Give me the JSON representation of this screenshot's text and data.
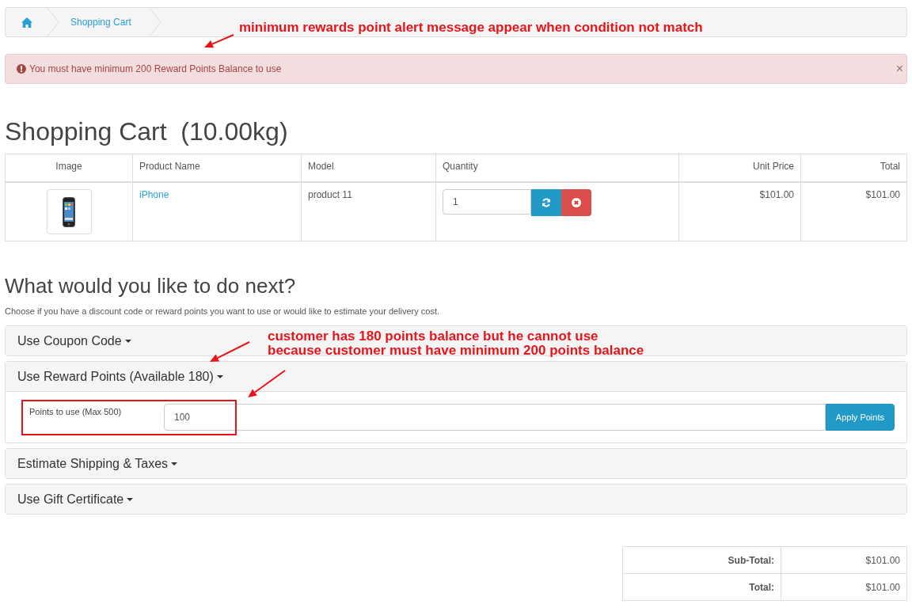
{
  "breadcrumb": [
    {
      "kind": "home"
    },
    {
      "kind": "link",
      "label": "Shopping Cart"
    }
  ],
  "alert": {
    "message": "You must have minimum 200 Reward Points Balance to use",
    "close": "×"
  },
  "heading": "Shopping Cart  (10.00kg)",
  "cart_table": {
    "columns": [
      "Image",
      "Product Name",
      "Model",
      "Quantity",
      "Unit Price",
      "Total"
    ],
    "rows": [
      {
        "product": "iPhone",
        "model": "product 11",
        "quantity": "1",
        "unit_price": "$101.00",
        "total": "$101.00"
      }
    ]
  },
  "next_steps": {
    "title": "What would you like to do next?",
    "description": "Choose if you have a discount code or reward points you want to use or would like to estimate your delivery cost.",
    "panels": [
      {
        "title": "Use Coupon Code",
        "expanded": false
      },
      {
        "title": "Use Reward Points (Available 180)",
        "expanded": true,
        "field_label": "Points to use (Max 500)",
        "value": "100",
        "button": "Apply Points"
      },
      {
        "title": "Estimate Shipping & Taxes",
        "expanded": false
      },
      {
        "title": "Use Gift Certificate",
        "expanded": false
      }
    ]
  },
  "totals": [
    {
      "label": "Sub-Total:",
      "value": "$101.00"
    },
    {
      "label": "Total:",
      "value": "$101.00"
    }
  ],
  "annotations": [
    {
      "lines": [
        "minimum rewards point alert message appear when condition not match"
      ]
    },
    {
      "lines": [
        "customer has 180 points balance but he cannot use",
        "because customer must have minimum 200 points balance"
      ]
    }
  ]
}
